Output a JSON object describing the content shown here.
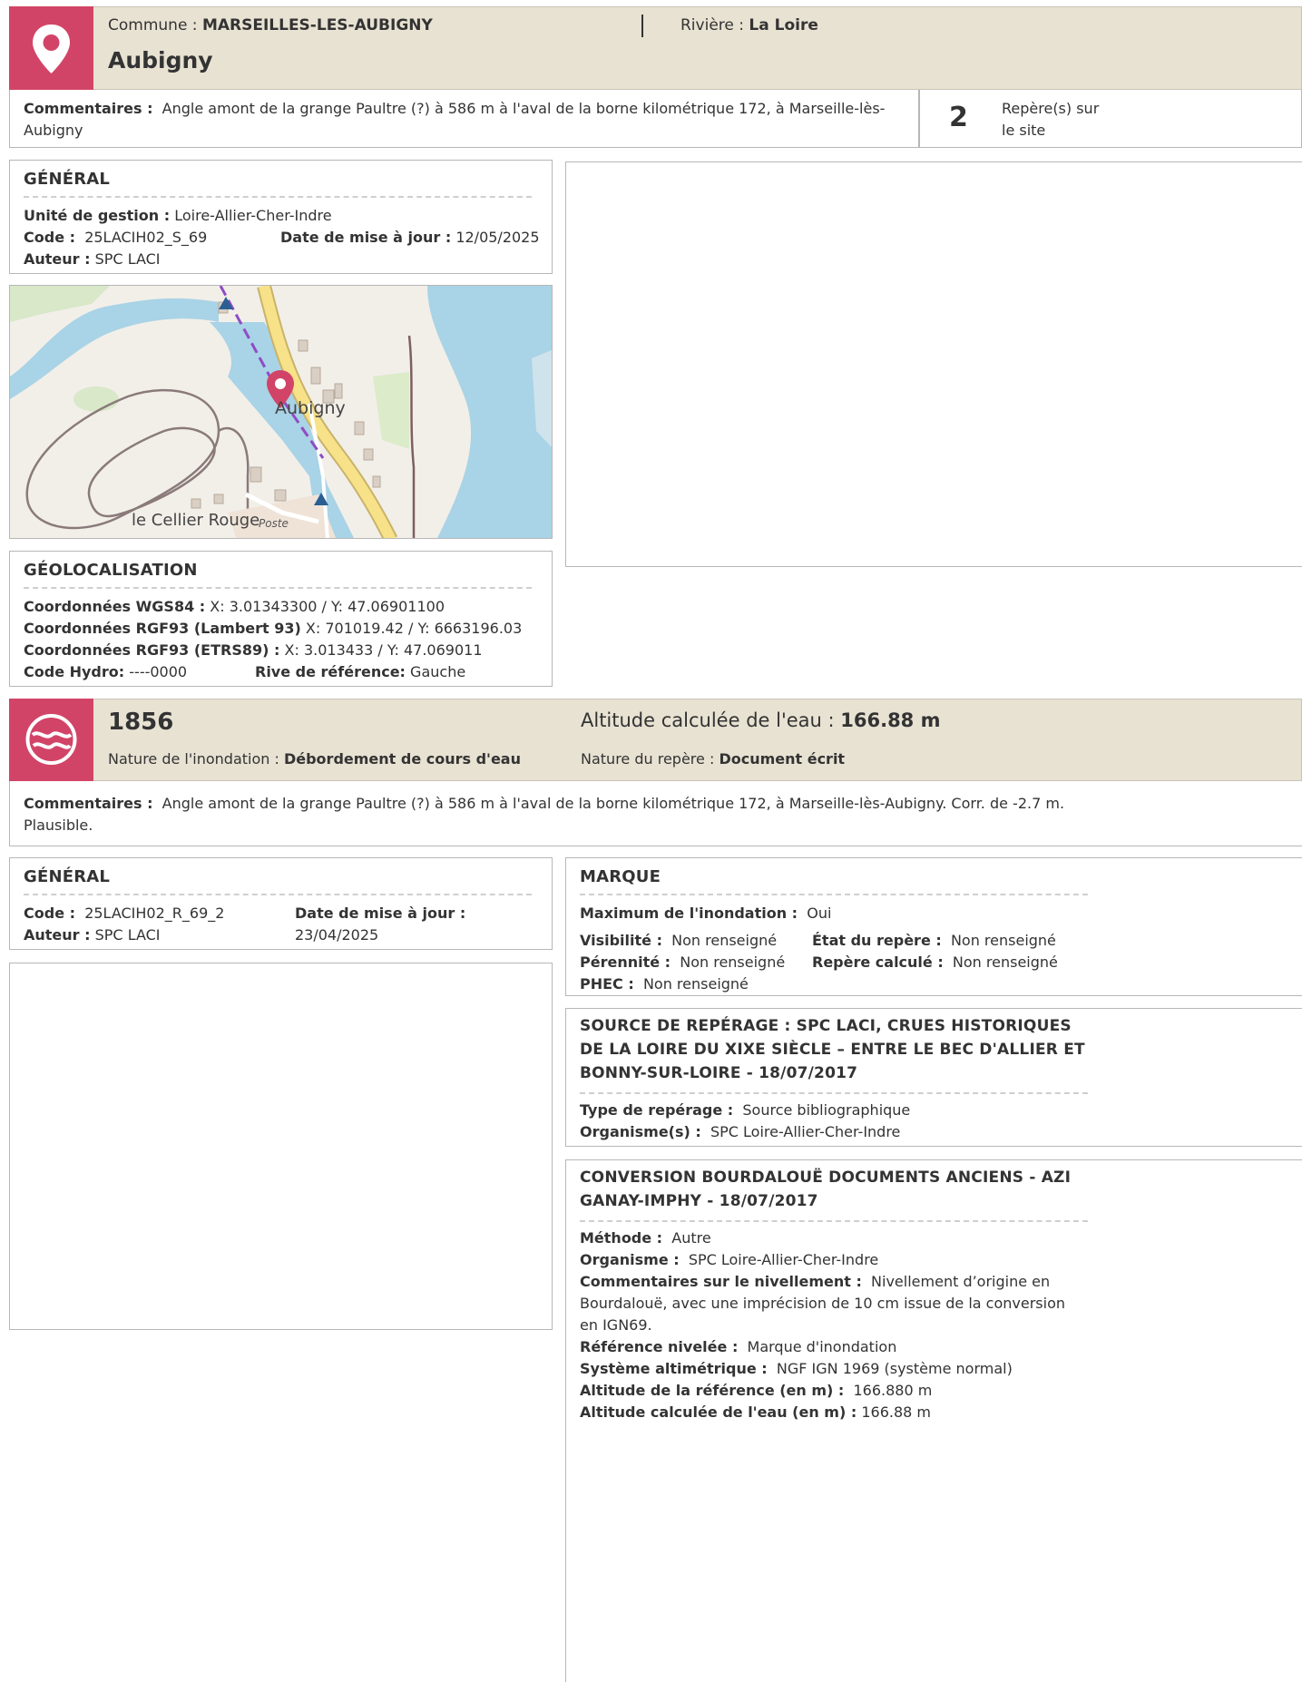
{
  "site": {
    "commune_label": "Commune : ",
    "commune": "MARSEILLES-LES-AUBIGNY",
    "riviere_label": "Rivière : ",
    "riviere": "La Loire",
    "title": "Aubigny",
    "commentaires_label": "Commentaires :",
    "commentaires": "Angle amont de la grange Paultre (?) à 586 m à l'aval de la borne kilométrique 172, à Marseille-lès-Aubigny",
    "reperes_count": "2",
    "reperes_label": "Repère(s) sur le site"
  },
  "general": {
    "title": "GÉNÉRAL",
    "unite_label": "Unité de gestion :",
    "unite": "Loire-Allier-Cher-Indre",
    "code_label": "Code :",
    "code": "25LACIH02_S_69",
    "maj_label": "Date de mise à jour :",
    "maj": "12/05/2025",
    "auteur_label": "Auteur :",
    "auteur": "SPC LACI"
  },
  "map": {
    "place_label": "Aubigny",
    "village_label": "le Cellier Rouge",
    "poste_label": "Poste",
    "colors": {
      "water": "#a9d3e6",
      "land": "#f2efe9",
      "road": "#f7e28a",
      "pin": "#d24467",
      "route": "#8f4cc4"
    }
  },
  "geoloc": {
    "title": "GÉOLOCALISATION",
    "wgs84_label": "Coordonnées WGS84 :",
    "wgs84": "X: 3.01343300 / Y: 47.06901100",
    "lambert_label": "Coordonnées RGF93 (Lambert 93)",
    "lambert": "X: 701019.42 / Y: 6663196.03",
    "etrs_label": "Coordonnées RGF93 (ETRS89) :",
    "etrs": "X: 3.013433 / Y: 47.069011",
    "hydro_label": "Code Hydro:",
    "hydro": "----0000",
    "rive_label": "Rive de référence:",
    "rive": "Gauche"
  },
  "repere": {
    "year": "1856",
    "altitude_label": "Altitude calculée de l'eau : ",
    "altitude": "166.88 m",
    "nature_inond_label": "Nature de l'inondation : ",
    "nature_inond": "Débordement de cours d'eau",
    "nature_rep_label": "Nature du repère : ",
    "nature_rep": "Document écrit",
    "commentaires_label": "Commentaires :",
    "commentaires": "Angle amont de la grange Paultre (?) à 586 m à l'aval de la borne kilométrique 172, à Marseille-lès-Aubigny. Corr. de -2.7 m. Plausible."
  },
  "general2": {
    "title": "GÉNÉRAL",
    "code_label": "Code :",
    "code": "25LACIH02_R_69_2",
    "maj_label": "Date de mise à jour :",
    "maj": "23/04/2025",
    "auteur_label": "Auteur :",
    "auteur": "SPC LACI"
  },
  "marque": {
    "title": "MARQUE",
    "max_label": "Maximum de l'inondation :",
    "max": "Oui",
    "visibilite_label": "Visibilité :",
    "visibilite": "Non renseigné",
    "etat_label": "État du repère :",
    "etat": "Non renseigné",
    "perennite_label": "Pérennité :",
    "perennite": "Non renseigné",
    "calcule_label": "Repère calculé :",
    "calcule": "Non renseigné",
    "phec_label": "PHEC :",
    "phec": "Non renseigné"
  },
  "source": {
    "title": "SOURCE DE REPÉRAGE : SPC LACI, CRUES HISTORIQUES DE LA LOIRE DU XIXE SIÈCLE – ENTRE LE BEC D'ALLIER ET BONNY-SUR-LOIRE - 18/07/2017",
    "type_label": "Type de repérage :",
    "type": "Source bibliographique",
    "org_label": "Organisme(s) :",
    "org": "SPC Loire-Allier-Cher-Indre"
  },
  "conversion": {
    "title": "CONVERSION BOURDALOUË DOCUMENTS ANCIENS - AZI GANAY-IMPHY - 18/07/2017",
    "methode_label": "Méthode :",
    "methode": "Autre",
    "org_label": "Organisme :",
    "org": "SPC Loire-Allier-Cher-Indre",
    "comm_label": "Commentaires sur le nivellement :",
    "comm": "Nivellement d’origine en Bourdalouë, avec une imprécision de 10 cm issue de la conversion en IGN69.",
    "ref_label": "Référence nivelée :",
    "ref": "Marque d'inondation",
    "sys_label": "Système altimétrique :",
    "sys": "NGF IGN 1969 (système normal)",
    "alt_ref_label": "Altitude de la référence (en m) :",
    "alt_ref": "166.880 m",
    "alt_eau_label": "Altitude calculée de l'eau (en m) :",
    "alt_eau": "166.88 m"
  }
}
